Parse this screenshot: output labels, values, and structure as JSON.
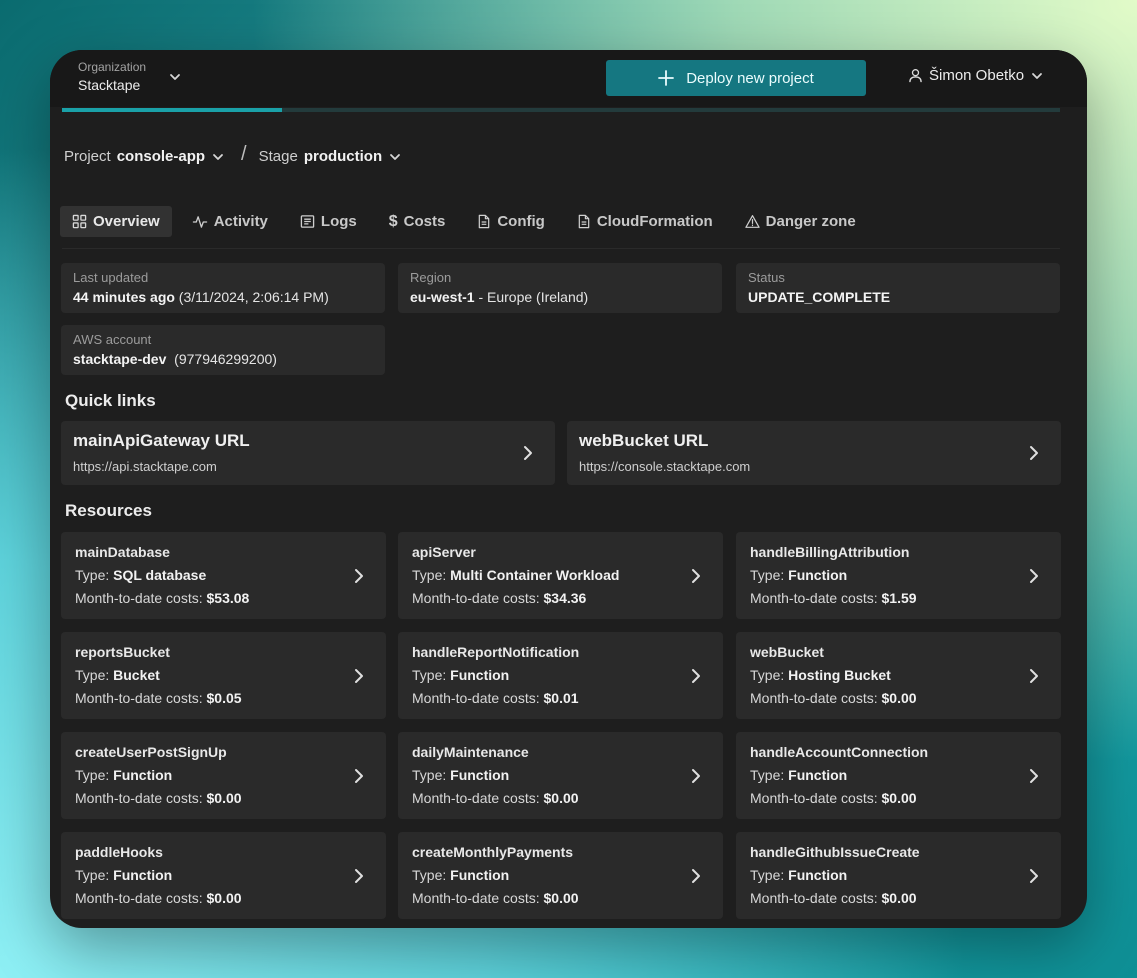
{
  "topbar": {
    "org_label": "Organization",
    "org_name": "Stacktape",
    "deploy_label": "Deploy new project",
    "user_name": "Šimon Obetko",
    "progress_percent": 22
  },
  "breadcrumb": {
    "project_prefix": "Project",
    "project_name": "console-app",
    "separator": "/",
    "stage_prefix": "Stage",
    "stage_name": "production"
  },
  "tabs": [
    {
      "label": "Overview",
      "icon": "grid-icon",
      "active": true
    },
    {
      "label": "Activity",
      "icon": "activity-icon"
    },
    {
      "label": "Logs",
      "icon": "logs-icon"
    },
    {
      "label": "Costs",
      "icon": "dollar-icon"
    },
    {
      "label": "Config",
      "icon": "file-icon"
    },
    {
      "label": "CloudFormation",
      "icon": "file-icon"
    },
    {
      "label": "Danger zone",
      "icon": "warning-icon"
    }
  ],
  "info": {
    "last_updated": {
      "label": "Last updated",
      "value_bold": "44 minutes ago",
      "value_rest": " (3/11/2024, 2:06:14 PM)"
    },
    "region": {
      "label": "Region",
      "value_bold": "eu-west-1",
      "value_rest": " - Europe (Ireland)"
    },
    "status": {
      "label": "Status",
      "value_bold": "UPDATE_COMPLETE",
      "value_rest": ""
    },
    "aws_account": {
      "label": "AWS account",
      "value_bold": "stacktape-dev",
      "value_rest": "  (977946299200)"
    }
  },
  "quick_links": {
    "title": "Quick links",
    "items": [
      {
        "title": "mainApiGateway URL",
        "url": "https://api.stacktape.com"
      },
      {
        "title": "webBucket URL",
        "url": "https://console.stacktape.com"
      }
    ]
  },
  "resources": {
    "title": "Resources",
    "type_prefix": "Type:",
    "cost_prefix": "Month-to-date costs:",
    "items": [
      {
        "name": "mainDatabase",
        "type": "SQL database",
        "cost": "$53.08"
      },
      {
        "name": "apiServer",
        "type": "Multi Container Workload",
        "cost": "$34.36"
      },
      {
        "name": "handleBillingAttribution",
        "type": "Function",
        "cost": "$1.59"
      },
      {
        "name": "reportsBucket",
        "type": "Bucket",
        "cost": "$0.05"
      },
      {
        "name": "handleReportNotification",
        "type": "Function",
        "cost": "$0.01"
      },
      {
        "name": "webBucket",
        "type": "Hosting Bucket",
        "cost": "$0.00"
      },
      {
        "name": "createUserPostSignUp",
        "type": "Function",
        "cost": "$0.00"
      },
      {
        "name": "dailyMaintenance",
        "type": "Function",
        "cost": "$0.00"
      },
      {
        "name": "handleAccountConnection",
        "type": "Function",
        "cost": "$0.00"
      },
      {
        "name": "paddleHooks",
        "type": "Function",
        "cost": "$0.00"
      },
      {
        "name": "createMonthlyPayments",
        "type": "Function",
        "cost": "$0.00"
      },
      {
        "name": "handleGithubIssueCreate",
        "type": "Function",
        "cost": "$0.00"
      }
    ]
  }
}
